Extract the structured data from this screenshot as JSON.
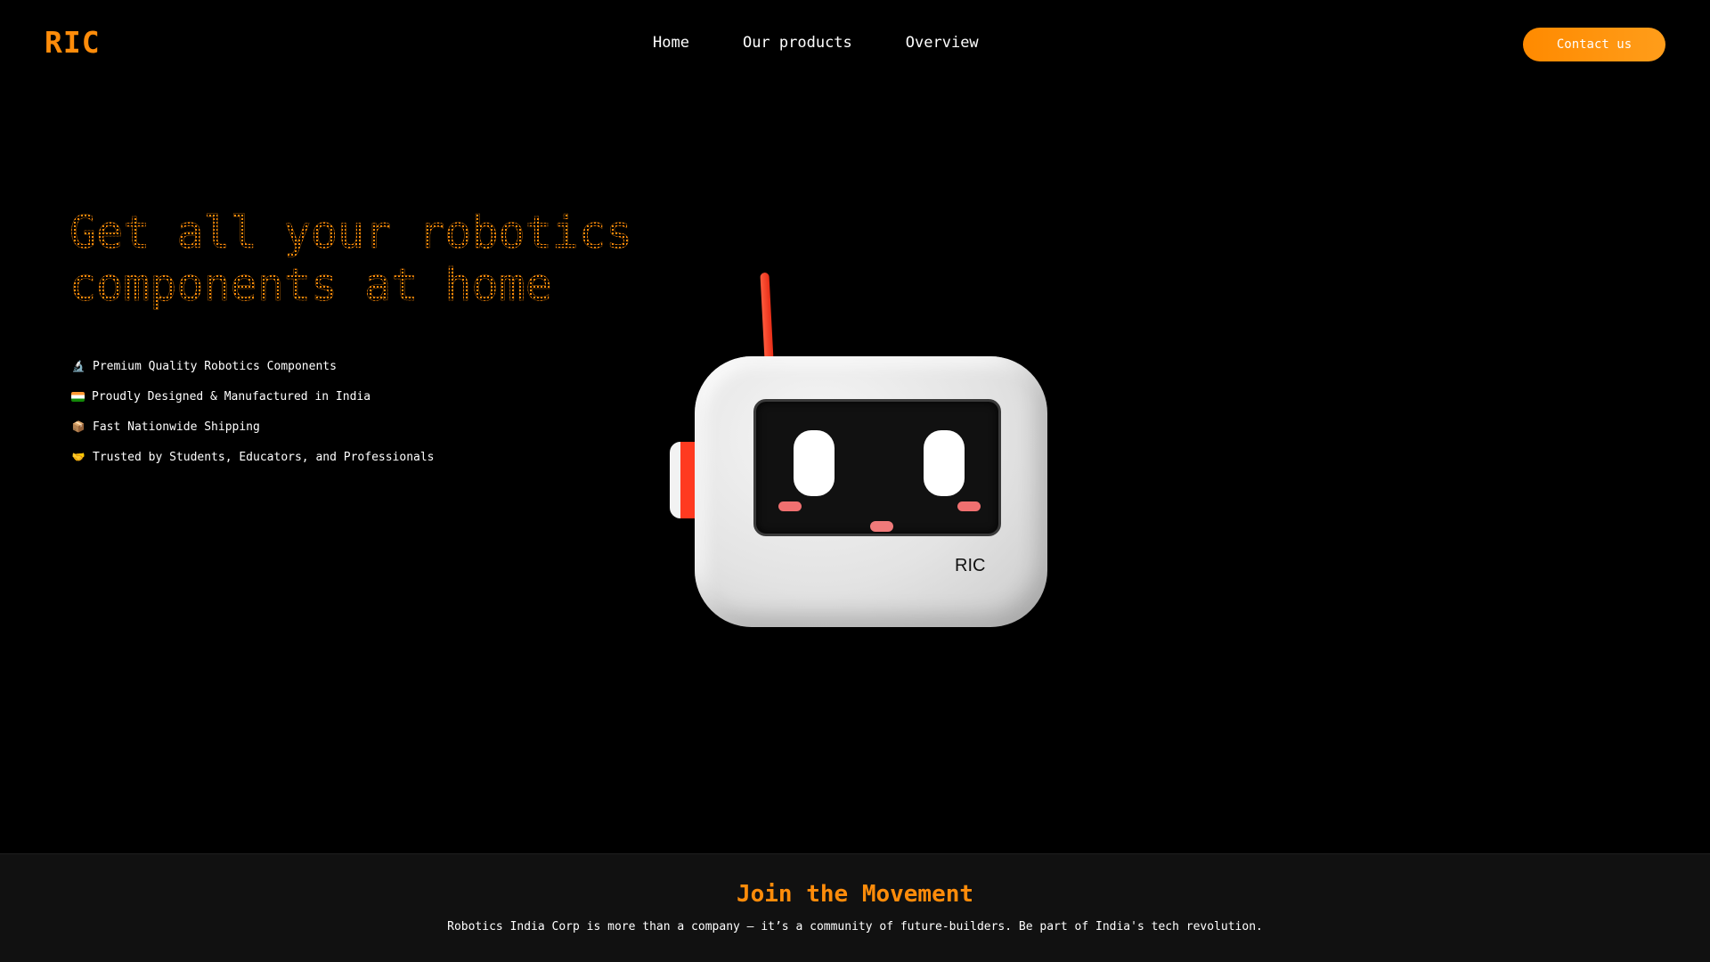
{
  "brand": {
    "logo": "RIC",
    "accent": "#ff8c0a"
  },
  "nav": {
    "items": [
      "Home",
      "Our products",
      "Overview"
    ]
  },
  "header": {
    "contact_label": "Contact us"
  },
  "hero": {
    "title": "Get all your robotics components at home",
    "features": [
      {
        "icon": "microscope-icon",
        "glyph": "🔬",
        "text": "Premium Quality Robotics Components"
      },
      {
        "icon": "india-flag-icon",
        "glyph": "",
        "text": "Proudly Designed & Manufactured in India"
      },
      {
        "icon": "package-icon",
        "glyph": "📦",
        "text": "Fast Nationwide Shipping"
      },
      {
        "icon": "handshake-icon",
        "glyph": "🤝",
        "text": "Trusted by Students, Educators, and Professionals"
      }
    ]
  },
  "robot": {
    "label": "RIC"
  },
  "movement": {
    "title": "Join the Movement",
    "text": "Robotics India Corp is more than a company — it’s a community of future-builders. Be part of India's tech revolution."
  }
}
